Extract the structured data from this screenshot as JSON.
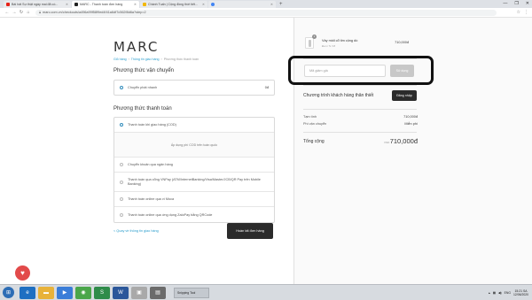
{
  "browser": {
    "tabs": [
      {
        "title": "Bài hát Sự thật ngày mai đã có...",
        "color": "#e62117",
        "active": false
      },
      {
        "title": "MARC - Thanh toán đơn hàng",
        "color": "#222222",
        "active": true
      },
      {
        "title": "Chánh Tuấn | Cộng đồng thời tiết...",
        "color": "#f2b705",
        "active": false
      },
      {
        "title": "",
        "color": "#4285f4",
        "active": false
      }
    ],
    "new_tab": "+",
    "url": "marc.com.vn/checkouts/a496a99f58f9ed4f41a6df7c562f8d6a?step=2",
    "win_controls": [
      "—",
      "❐",
      "✕"
    ],
    "toolbar_icons": [
      "☆",
      "⋮"
    ]
  },
  "store": {
    "logo": "MARC",
    "breadcrumb": [
      "Giỏ hàng",
      "Thông tin giao hàng",
      "Phương thức thanh toán"
    ]
  },
  "shipping": {
    "title": "Phương thức vận chuyển",
    "option": "Chuyển phát nhanh",
    "price": "0đ"
  },
  "payment": {
    "title": "Phương thức thanh toán",
    "options": [
      {
        "label": "Thanh toán khi giao hàng (COD)",
        "selected": true
      },
      {
        "label": "Chuyển khoản qua ngân hàng",
        "selected": false
      },
      {
        "label": "Thanh toán qua cổng VNPay (ATM/InternetBanking/Visa/Master/JCB/QR Pay trên Mobile Banking)",
        "selected": false
      },
      {
        "label": "Thanh toán online qua ví Moca",
        "selected": false
      },
      {
        "label": "Thanh toán online qua ứng dụng ZaloPay bằng QRCode",
        "selected": false
      }
    ],
    "cod_note": "Áp dụng phí COD trên toàn quốc"
  },
  "actions": {
    "back_link": "< Quay về thông tin giao hàng",
    "complete_button": "Hoàn tất đơn hàng"
  },
  "order": {
    "product_name": "Váy midi cổ tim cộng dồ",
    "product_variant": "Đen / S / M",
    "product_qty": "1",
    "product_price": "710,000đ",
    "discount_placeholder": "Mã giảm giá",
    "discount_button": "Sử dụng",
    "loyalty_text": "Chương trình khách hàng thân thiết",
    "login_button": "Đăng nhập",
    "subtotal_label": "Tạm tính",
    "subtotal_value": "710,000đ",
    "shipping_label": "Phí vận chuyển",
    "shipping_value": "Miễn phí",
    "total_label": "Tổng cộng",
    "total_currency": "VND",
    "total_value": "710,000đ"
  },
  "taskbar": {
    "window_title": "Snipping Tool",
    "tray_lang": "ENG",
    "time": "15:21 SA",
    "date": "12/06/2020"
  }
}
